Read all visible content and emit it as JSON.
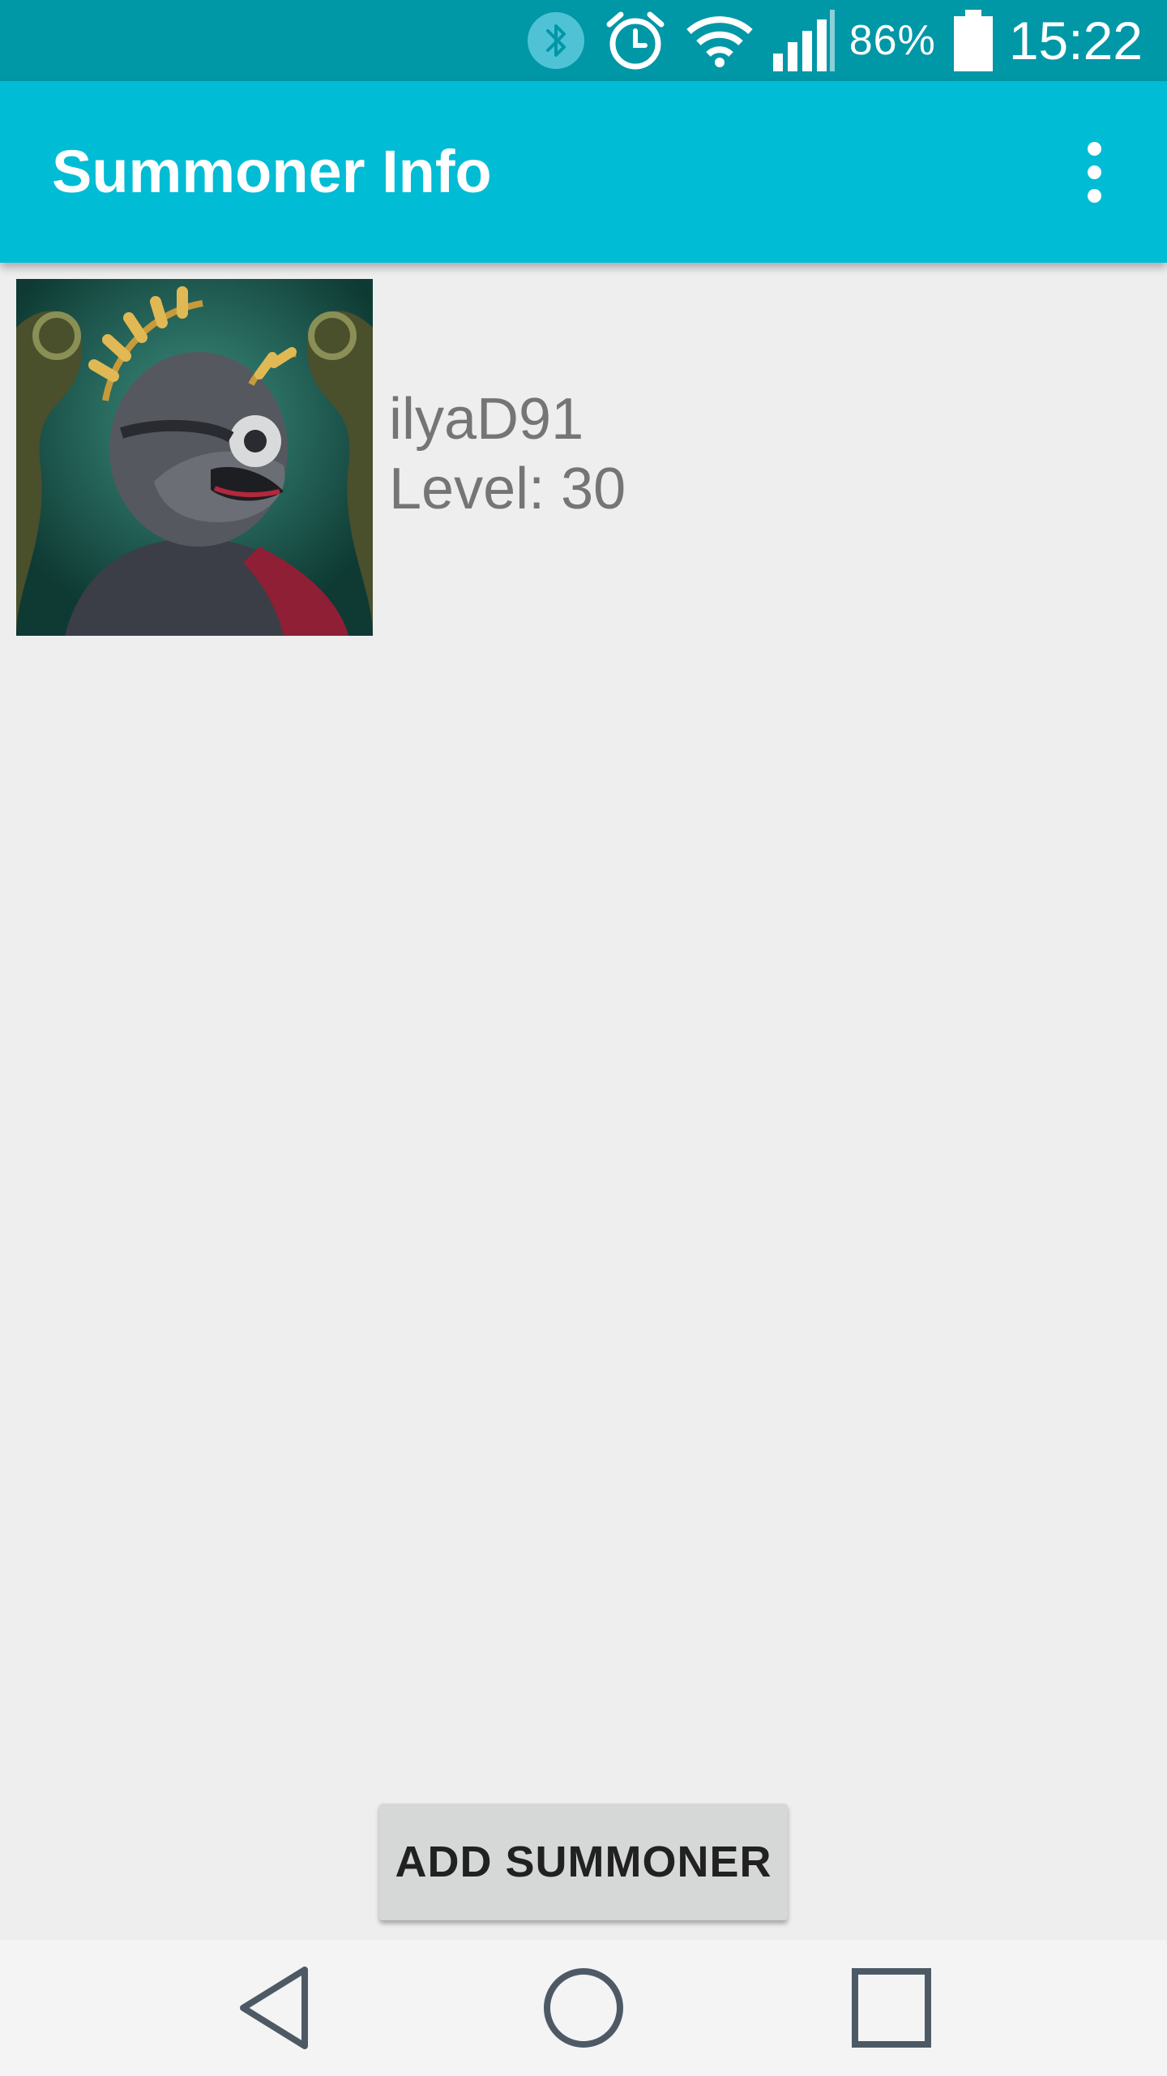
{
  "status_bar": {
    "icons": [
      "bluetooth-icon",
      "alarm-icon",
      "wifi-icon",
      "cell-signal-icon",
      "battery-icon"
    ],
    "battery_percent": "86%",
    "battery_level": 0.86,
    "time": "15:22"
  },
  "app_bar": {
    "title": "Summoner Info",
    "menu_icon": "more-vert-icon"
  },
  "summoner": {
    "avatar_icon": "profile-icon",
    "name": "ilyaD91",
    "level": "Level: 30"
  },
  "add_button": {
    "label": "ADD SUMMONER"
  },
  "nav_bar": {
    "icons": [
      "back-icon",
      "home-icon",
      "recents-icon"
    ]
  },
  "colors": {
    "status_bar": "#0097a7",
    "app_bar": "#00bcd4",
    "background": "#eeeeee",
    "button": "#d6d7d7",
    "secondary_text": "#757575",
    "nav_icon": "#4d5a66"
  }
}
